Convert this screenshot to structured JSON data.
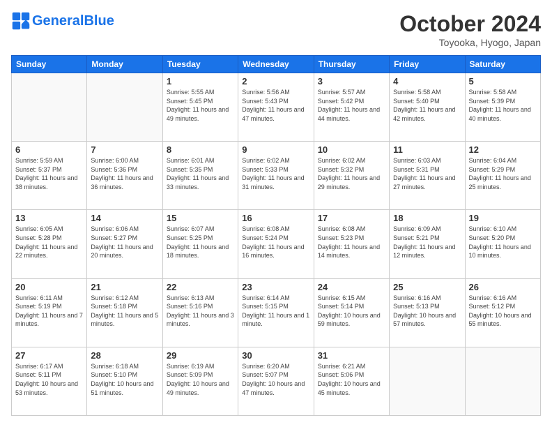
{
  "header": {
    "logo_general": "General",
    "logo_blue": "Blue",
    "title": "October 2024",
    "location": "Toyooka, Hyogo, Japan"
  },
  "days_of_week": [
    "Sunday",
    "Monday",
    "Tuesday",
    "Wednesday",
    "Thursday",
    "Friday",
    "Saturday"
  ],
  "weeks": [
    [
      {
        "day": "",
        "info": ""
      },
      {
        "day": "",
        "info": ""
      },
      {
        "day": "1",
        "info": "Sunrise: 5:55 AM\nSunset: 5:45 PM\nDaylight: 11 hours and 49 minutes."
      },
      {
        "day": "2",
        "info": "Sunrise: 5:56 AM\nSunset: 5:43 PM\nDaylight: 11 hours and 47 minutes."
      },
      {
        "day": "3",
        "info": "Sunrise: 5:57 AM\nSunset: 5:42 PM\nDaylight: 11 hours and 44 minutes."
      },
      {
        "day": "4",
        "info": "Sunrise: 5:58 AM\nSunset: 5:40 PM\nDaylight: 11 hours and 42 minutes."
      },
      {
        "day": "5",
        "info": "Sunrise: 5:58 AM\nSunset: 5:39 PM\nDaylight: 11 hours and 40 minutes."
      }
    ],
    [
      {
        "day": "6",
        "info": "Sunrise: 5:59 AM\nSunset: 5:37 PM\nDaylight: 11 hours and 38 minutes."
      },
      {
        "day": "7",
        "info": "Sunrise: 6:00 AM\nSunset: 5:36 PM\nDaylight: 11 hours and 36 minutes."
      },
      {
        "day": "8",
        "info": "Sunrise: 6:01 AM\nSunset: 5:35 PM\nDaylight: 11 hours and 33 minutes."
      },
      {
        "day": "9",
        "info": "Sunrise: 6:02 AM\nSunset: 5:33 PM\nDaylight: 11 hours and 31 minutes."
      },
      {
        "day": "10",
        "info": "Sunrise: 6:02 AM\nSunset: 5:32 PM\nDaylight: 11 hours and 29 minutes."
      },
      {
        "day": "11",
        "info": "Sunrise: 6:03 AM\nSunset: 5:31 PM\nDaylight: 11 hours and 27 minutes."
      },
      {
        "day": "12",
        "info": "Sunrise: 6:04 AM\nSunset: 5:29 PM\nDaylight: 11 hours and 25 minutes."
      }
    ],
    [
      {
        "day": "13",
        "info": "Sunrise: 6:05 AM\nSunset: 5:28 PM\nDaylight: 11 hours and 22 minutes."
      },
      {
        "day": "14",
        "info": "Sunrise: 6:06 AM\nSunset: 5:27 PM\nDaylight: 11 hours and 20 minutes."
      },
      {
        "day": "15",
        "info": "Sunrise: 6:07 AM\nSunset: 5:25 PM\nDaylight: 11 hours and 18 minutes."
      },
      {
        "day": "16",
        "info": "Sunrise: 6:08 AM\nSunset: 5:24 PM\nDaylight: 11 hours and 16 minutes."
      },
      {
        "day": "17",
        "info": "Sunrise: 6:08 AM\nSunset: 5:23 PM\nDaylight: 11 hours and 14 minutes."
      },
      {
        "day": "18",
        "info": "Sunrise: 6:09 AM\nSunset: 5:21 PM\nDaylight: 11 hours and 12 minutes."
      },
      {
        "day": "19",
        "info": "Sunrise: 6:10 AM\nSunset: 5:20 PM\nDaylight: 11 hours and 10 minutes."
      }
    ],
    [
      {
        "day": "20",
        "info": "Sunrise: 6:11 AM\nSunset: 5:19 PM\nDaylight: 11 hours and 7 minutes."
      },
      {
        "day": "21",
        "info": "Sunrise: 6:12 AM\nSunset: 5:18 PM\nDaylight: 11 hours and 5 minutes."
      },
      {
        "day": "22",
        "info": "Sunrise: 6:13 AM\nSunset: 5:16 PM\nDaylight: 11 hours and 3 minutes."
      },
      {
        "day": "23",
        "info": "Sunrise: 6:14 AM\nSunset: 5:15 PM\nDaylight: 11 hours and 1 minute."
      },
      {
        "day": "24",
        "info": "Sunrise: 6:15 AM\nSunset: 5:14 PM\nDaylight: 10 hours and 59 minutes."
      },
      {
        "day": "25",
        "info": "Sunrise: 6:16 AM\nSunset: 5:13 PM\nDaylight: 10 hours and 57 minutes."
      },
      {
        "day": "26",
        "info": "Sunrise: 6:16 AM\nSunset: 5:12 PM\nDaylight: 10 hours and 55 minutes."
      }
    ],
    [
      {
        "day": "27",
        "info": "Sunrise: 6:17 AM\nSunset: 5:11 PM\nDaylight: 10 hours and 53 minutes."
      },
      {
        "day": "28",
        "info": "Sunrise: 6:18 AM\nSunset: 5:10 PM\nDaylight: 10 hours and 51 minutes."
      },
      {
        "day": "29",
        "info": "Sunrise: 6:19 AM\nSunset: 5:09 PM\nDaylight: 10 hours and 49 minutes."
      },
      {
        "day": "30",
        "info": "Sunrise: 6:20 AM\nSunset: 5:07 PM\nDaylight: 10 hours and 47 minutes."
      },
      {
        "day": "31",
        "info": "Sunrise: 6:21 AM\nSunset: 5:06 PM\nDaylight: 10 hours and 45 minutes."
      },
      {
        "day": "",
        "info": ""
      },
      {
        "day": "",
        "info": ""
      }
    ]
  ]
}
